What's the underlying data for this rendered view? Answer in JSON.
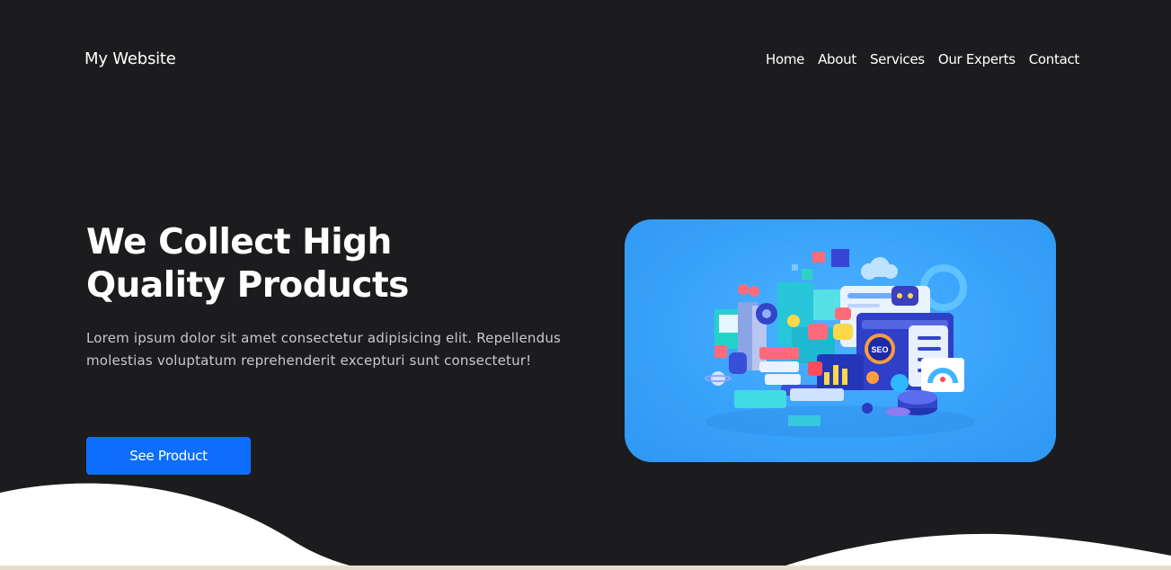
{
  "header": {
    "logo": "My Website",
    "nav": [
      {
        "label": "Home"
      },
      {
        "label": "About"
      },
      {
        "label": "Services"
      },
      {
        "label": "Our Experts"
      },
      {
        "label": "Contact"
      }
    ]
  },
  "hero": {
    "title_line1": "We Collect High",
    "title_line2": "Quality Products",
    "description": "Lorem ipsum dolor sit amet consectetur adipisicing elit. Repellendus molestias voluptatum reprehenderit excepturi sunt consectetur!",
    "cta_label": "See Product",
    "illustration_badge": "SEO"
  },
  "colors": {
    "background": "#1c1c1e",
    "accent": "#0d6efd",
    "image_bg": "#38a3fb",
    "wave": "#ffffff"
  }
}
